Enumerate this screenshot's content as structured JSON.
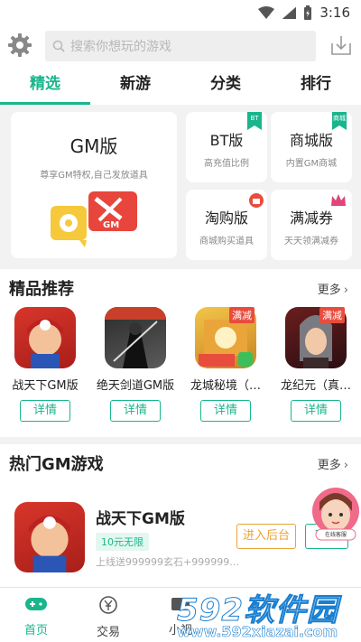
{
  "status": {
    "time": "3:16"
  },
  "search": {
    "placeholder": "搜索你想玩的游戏"
  },
  "tabs": [
    {
      "label": "精选"
    },
    {
      "label": "新游"
    },
    {
      "label": "分类"
    },
    {
      "label": "排行"
    }
  ],
  "categories": {
    "gm": {
      "title": "GM版",
      "sub": "尊享GM特权,自己发放道具"
    },
    "bt": {
      "title": "BT版",
      "sub": "高充值比例",
      "badge": "BT"
    },
    "mall": {
      "title": "商城版",
      "sub": "内置GM商城",
      "badge": "商城"
    },
    "taogou": {
      "title": "淘购版",
      "sub": "商城购买道具"
    },
    "manjian": {
      "title": "满减券",
      "sub": "天天领满减券"
    }
  },
  "featured": {
    "title": "精品推荐",
    "more": "更多",
    "games": [
      {
        "name": "战天下GM版",
        "button": "详情",
        "tag": ""
      },
      {
        "name": "绝天剑道GM版",
        "button": "详情",
        "tag": ""
      },
      {
        "name": "龙城秘境（…",
        "button": "详情",
        "tag": "满减"
      },
      {
        "name": "龙纪元（真…",
        "button": "详情",
        "tag": "满减"
      }
    ]
  },
  "hot": {
    "title": "热门GM游戏",
    "more": "更多",
    "game": {
      "name": "战天下GM版",
      "discount": "10元无限",
      "desc": "上线送999999玄石+999999…",
      "enter": "进入后台",
      "download": "下载"
    }
  },
  "kefu": {
    "label": "在线客服"
  },
  "bottom_nav": [
    {
      "label": "首页"
    },
    {
      "label": "交易"
    },
    {
      "label": "小视"
    }
  ],
  "watermark": {
    "big": "592软件园",
    "url": "www.592xiazai.com"
  },
  "colors": {
    "accent": "#19b68c",
    "orange": "#e8a33a",
    "tag_red": "#e84c3d"
  }
}
